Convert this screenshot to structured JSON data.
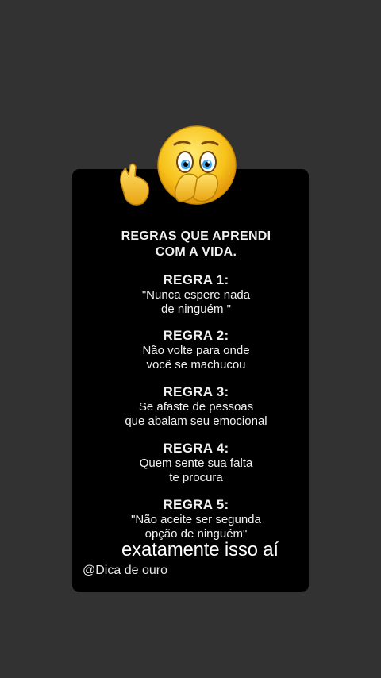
{
  "post": {
    "heading_line1": "REGRAS QUE APRENDI",
    "heading_line2": "COM A VIDA.",
    "rules": [
      {
        "title": "REGRA 1:",
        "text": "\"Nunca espere nada\nde ninguém \""
      },
      {
        "title": "REGRA 2:",
        "text": "Não volte para onde\nvocê se machucou"
      },
      {
        "title": "REGRA 3:",
        "text": "Se afaste de pessoas\nque abalam seu emocional"
      },
      {
        "title": "REGRA 4:",
        "text": "Quem sente sua falta\nte procura"
      },
      {
        "title": "REGRA 5:",
        "text": "\"Não aceite ser segunda\nopção de ninguém\""
      }
    ],
    "caption": "exatamente isso aí",
    "handle": "@Dica de ouro",
    "emoji": "clapping-face-emoji"
  },
  "colors": {
    "background": "#333232",
    "card": "#000000",
    "text": "#f1f1f1",
    "emoji_yellow": "#f7c21a"
  }
}
